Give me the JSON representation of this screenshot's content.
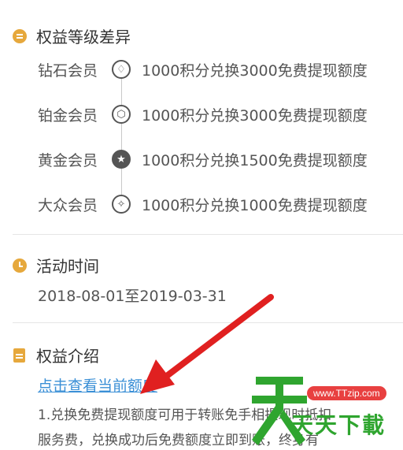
{
  "sections": {
    "tiers": {
      "title": "权益等级差异",
      "icon": "list-icon",
      "items": [
        {
          "name": "钻石会员",
          "icon": "diamond-icon",
          "glyph": "♢",
          "desc": "1000积分兑换3000免费提现额度"
        },
        {
          "name": "铂金会员",
          "icon": "hexagon-icon",
          "glyph": "⬡",
          "desc": "1000积分兑换3000免费提现额度"
        },
        {
          "name": "黄金会员",
          "icon": "star-icon",
          "glyph": "★",
          "desc": "1000积分兑换1500免费提现额度",
          "active": true
        },
        {
          "name": "大众会员",
          "icon": "sparkle-icon",
          "glyph": "✧",
          "desc": "1000积分兑换1000免费提现额度"
        }
      ]
    },
    "activity": {
      "title": "活动时间",
      "icon": "clock-icon",
      "period": "2018-08-01至2019-03-31"
    },
    "intro": {
      "title": "权益介绍",
      "icon": "document-icon",
      "link": "点击查看当前额度",
      "line1": "1.兑换免费提现额度可用于转账免手相提现时抵扣",
      "line2": "服务费，兑换成功后免费额度立即到账，终身有"
    }
  },
  "watermark": {
    "url": "www.TTzip.com",
    "text": "天天下載"
  },
  "colors": {
    "accent": "#e6a83c",
    "link": "#3a8fd6",
    "arrow": "#e02020"
  }
}
